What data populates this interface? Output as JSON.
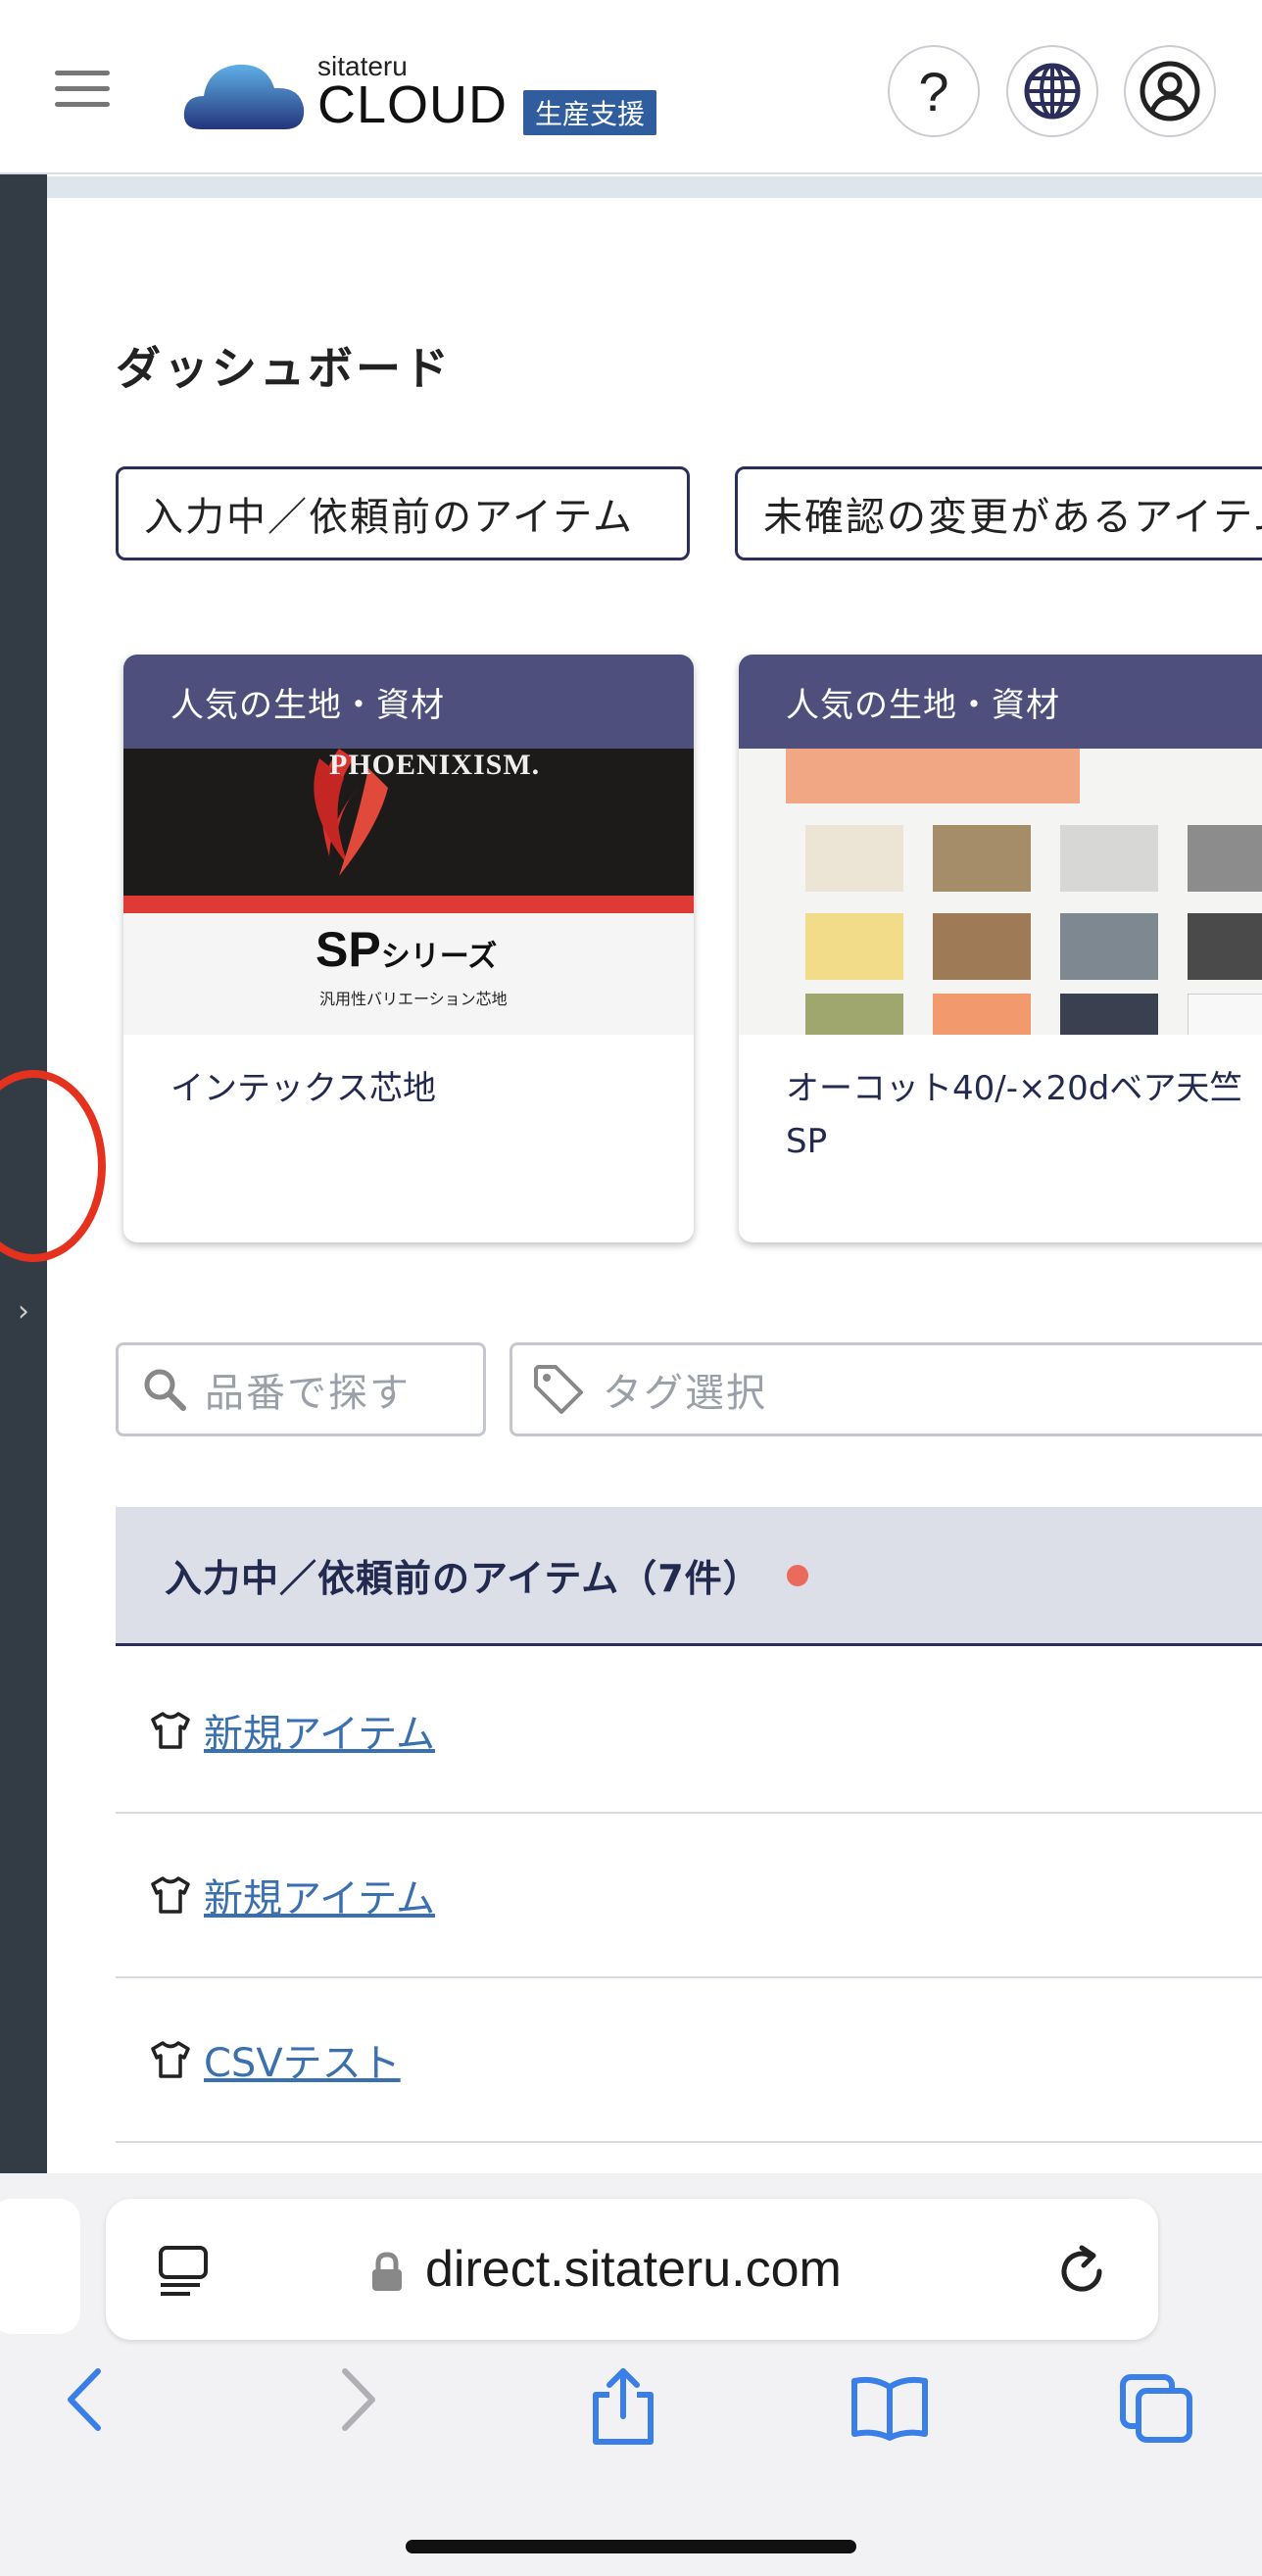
{
  "header": {
    "brand_small": "sitateru",
    "brand_big": "CLOUD",
    "brand_tag": "生産支援",
    "help_label": "?"
  },
  "dashboard": {
    "title": "ダッシュボード",
    "filters": [
      "入力中／依頼前のアイテム",
      "未確認の変更があるアイテム"
    ]
  },
  "cards": [
    {
      "header": "人気の生地・資材",
      "name": "インテックス芯地",
      "image_brand": "PHOENIXISM.",
      "image_title": "SP",
      "image_title_suffix": "シリーズ",
      "image_subtitle": "汎用性バリエーション芯地"
    },
    {
      "header": "人気の生地・資材",
      "name": "オーコット40/-×20dベア天竺SP"
    }
  ],
  "search": {
    "part_number_placeholder": "品番で探す",
    "tag_placeholder": "タグ選択"
  },
  "table": {
    "title": "入力中／依頼前のアイテム（7件）",
    "rows": [
      "新規アイテム",
      "新規アイテム",
      "CSVテスト"
    ]
  },
  "browser": {
    "url": "direct.sitateru.com"
  },
  "colors": {
    "rail": "#333b45",
    "card_header": "#4f4f7e",
    "link": "#3a6fb0",
    "annotation": "#e5321f",
    "status_dot": "#ea6a5b"
  }
}
